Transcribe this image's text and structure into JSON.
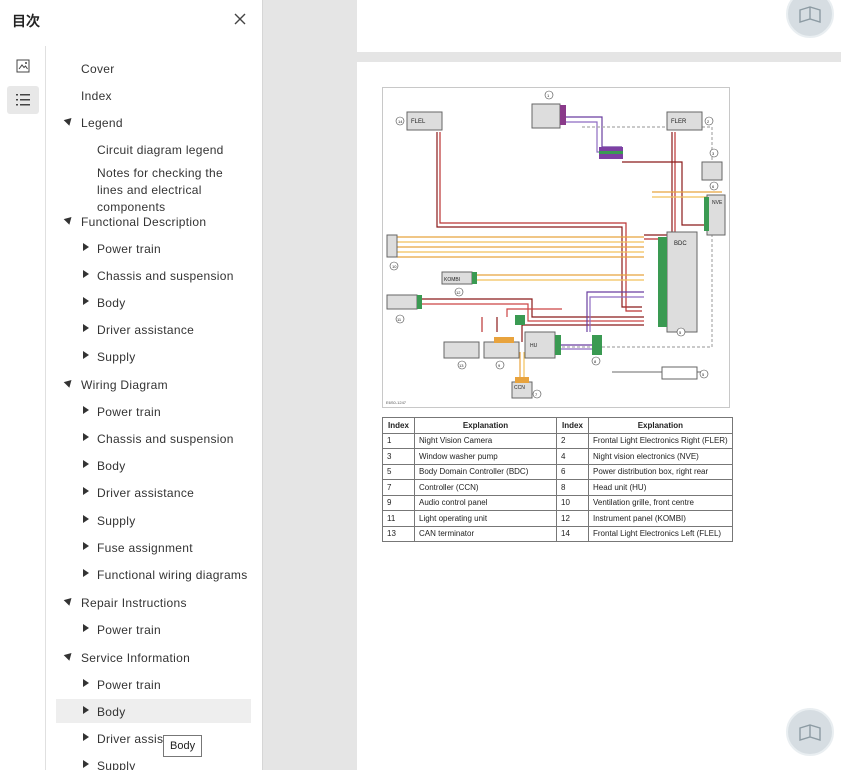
{
  "panel": {
    "title": "目次",
    "close_icon": "close-icon",
    "tools": [
      {
        "name": "thumbnails-icon",
        "active": false
      },
      {
        "name": "outline-list-icon",
        "active": true
      }
    ]
  },
  "toc": [
    {
      "label": "Cover",
      "level": 0,
      "caret": "none"
    },
    {
      "label": "Index",
      "level": 0,
      "caret": "none"
    },
    {
      "label": "Legend",
      "level": 0,
      "caret": "open"
    },
    {
      "label": "Circuit diagram legend",
      "level": 1,
      "caret": "none"
    },
    {
      "label": "Notes for checking the lines and electrical components",
      "level": 1,
      "caret": "none"
    },
    {
      "label": "Functional Description",
      "level": 0,
      "caret": "open"
    },
    {
      "label": "Power train",
      "level": 1,
      "caret": "closed"
    },
    {
      "label": "Chassis and suspension",
      "level": 1,
      "caret": "closed"
    },
    {
      "label": "Body",
      "level": 1,
      "caret": "closed"
    },
    {
      "label": "Driver assistance",
      "level": 1,
      "caret": "closed"
    },
    {
      "label": "Supply",
      "level": 1,
      "caret": "closed"
    },
    {
      "label": "Wiring Diagram",
      "level": 0,
      "caret": "open"
    },
    {
      "label": "Power train",
      "level": 1,
      "caret": "closed"
    },
    {
      "label": "Chassis and suspension",
      "level": 1,
      "caret": "closed"
    },
    {
      "label": "Body",
      "level": 1,
      "caret": "closed"
    },
    {
      "label": "Driver assistance",
      "level": 1,
      "caret": "closed"
    },
    {
      "label": "Supply",
      "level": 1,
      "caret": "closed"
    },
    {
      "label": "Fuse assignment",
      "level": 1,
      "caret": "closed"
    },
    {
      "label": "Functional wiring diagrams",
      "level": 1,
      "caret": "closed"
    },
    {
      "label": "Repair Instructions",
      "level": 0,
      "caret": "open"
    },
    {
      "label": "Power train",
      "level": 1,
      "caret": "closed"
    },
    {
      "label": "Service Information",
      "level": 0,
      "caret": "open"
    },
    {
      "label": "Power train",
      "level": 1,
      "caret": "closed"
    },
    {
      "label": "Body",
      "level": 1,
      "caret": "closed",
      "selected": true
    },
    {
      "label": "Driver assistance",
      "level": 1,
      "caret": "closed"
    },
    {
      "label": "Supply",
      "level": 1,
      "caret": "closed"
    }
  ],
  "tooltip": "Body",
  "diagram": {
    "components": [
      {
        "label": "FLEL",
        "num": "14"
      },
      {
        "label": "FLER",
        "num": "2"
      },
      {
        "label": "",
        "num": "1"
      },
      {
        "label": "",
        "num": "3"
      },
      {
        "label": "NVE",
        "num": "4"
      },
      {
        "label": "BDC",
        "num": "5"
      },
      {
        "label": "KOMBI",
        "num": "12"
      },
      {
        "label": "HU",
        "num": "8"
      },
      {
        "label": "CCN",
        "num": "7"
      }
    ],
    "image_code": "E6S0-1247"
  },
  "table": {
    "headers": [
      "Index",
      "Explanation",
      "Index",
      "Explanation"
    ],
    "rows": [
      [
        "1",
        "Night Vision Camera",
        "2",
        "Frontal Light Electronics Right (FLER)"
      ],
      [
        "3",
        "Window washer pump",
        "4",
        "Night vision electronics (NVE)"
      ],
      [
        "5",
        "Body Domain Controller (BDC)",
        "6",
        "Power distribution box, right rear"
      ],
      [
        "7",
        "Controller (CCN)",
        "8",
        "Head unit (HU)"
      ],
      [
        "9",
        "Audio control panel",
        "10",
        "Ventilation grille, front centre"
      ],
      [
        "11",
        "Light operating unit",
        "12",
        "Instrument panel (KOMBI)"
      ],
      [
        "13",
        "CAN terminator",
        "14",
        "Frontal Light Electronics Left (FLEL)"
      ]
    ]
  },
  "watermark_icon": "book-globe-logo-icon"
}
